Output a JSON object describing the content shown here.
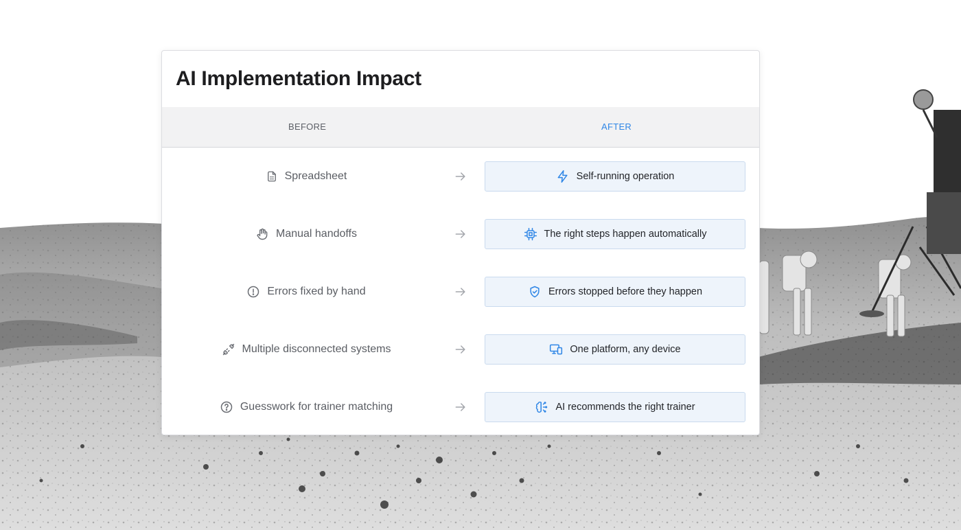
{
  "card": {
    "title": "AI Implementation Impact",
    "before_header": "BEFORE",
    "after_header": "AFTER"
  },
  "colors": {
    "accent": "#2f86e6",
    "after_bg": "#eef4fb",
    "header_bg": "#f2f2f3"
  },
  "rows": [
    {
      "before": "Spreadsheet",
      "before_icon": "spreadsheet-icon",
      "after": "Self-running operation",
      "after_icon": "lightning-icon"
    },
    {
      "before": "Manual handoffs",
      "before_icon": "hand-icon",
      "after": "The right steps happen automatically",
      "after_icon": "chip-icon"
    },
    {
      "before": "Errors fixed by hand",
      "before_icon": "alert-circle-icon",
      "after": "Errors stopped before they happen",
      "after_icon": "shield-check-icon"
    },
    {
      "before": "Multiple disconnected systems",
      "before_icon": "disconnected-plug-icon",
      "after": "One platform, any device",
      "after_icon": "devices-icon"
    },
    {
      "before": "Guesswork for trainer matching",
      "before_icon": "question-circle-icon",
      "after": "AI recommends the right trainer",
      "after_icon": "brain-icon"
    }
  ]
}
